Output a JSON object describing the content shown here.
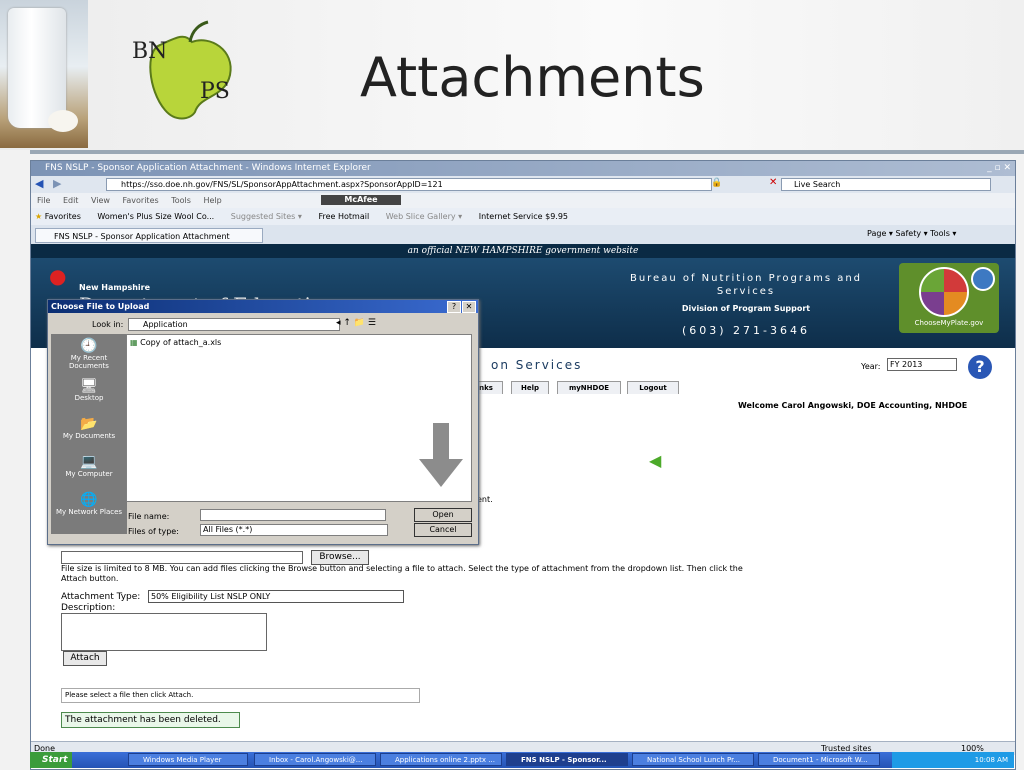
{
  "slide": {
    "title": "Attachments",
    "logo_top": "BN",
    "logo_bottom": "PS"
  },
  "ie": {
    "title": "FNS NSLP - Sponsor Application Attachment - Windows Internet Explorer",
    "address": "https://sso.doe.nh.gov/FNS/SL/SponsorAppAttachment.aspx?SponsorAppID=121",
    "search_placeholder": "Live Search",
    "menu": [
      "File",
      "Edit",
      "View",
      "Favorites",
      "Tools",
      "Help"
    ],
    "mcafee": "McAfee",
    "favorites_label": "Favorites",
    "favorites": [
      "Women's Plus Size Wool Co...",
      "Suggested Sites ▾",
      "Free Hotmail",
      "Web Slice Gallery ▾",
      "Internet Service $9.95"
    ],
    "tab_label": "FNS NSLP - Sponsor Application Attachment",
    "cmd": "Page ▾  Safety ▾  Tools ▾",
    "status_left": "Done",
    "status_zone": "Trusted sites",
    "zoom": "100%"
  },
  "site": {
    "strip": "an official NEW HAMPSHIRE government website",
    "doe_small": "New Hampshire",
    "doe_big": "Department of Education",
    "bureau": "Bureau of Nutrition Programs and Services",
    "division": "Division of Program Support",
    "phone": "(603) 271-3646",
    "myplate": "ChooseMyPlate.gov",
    "services_fragment": "on Services",
    "year_label": "Year:",
    "year_value": "FY 2013",
    "nav": [
      "nks",
      "Help",
      "myNHDOE",
      "Logout"
    ],
    "welcome": "Welcome Carol Angowski, DOE Accounting, NHDOE",
    "ment": "ent.",
    "browse": "Browse...",
    "info": "File size is limited to 8 MB. You can add files clicking the Browse button and selecting a file to attach. Select the type of attachment from the dropdown list. Then click the Attach button.",
    "attachment_type_label": "Attachment Type:",
    "attachment_type_value": "50% Eligibility List NSLP ONLY",
    "description_label": "Description:",
    "attach_button": "Attach",
    "status_select": "Please select a file then click Attach.",
    "status_deleted": "The attachment has been deleted."
  },
  "dialog": {
    "title": "Choose File to Upload",
    "look_in_label": "Look in:",
    "look_in_value": "Application",
    "places": [
      "My Recent Documents",
      "Desktop",
      "My Documents",
      "My Computer",
      "My Network Places"
    ],
    "file": "Copy of attach_a.xls",
    "file_name_label": "File name:",
    "files_of_type_label": "Files of type:",
    "files_of_type_value": "All Files (*.*)",
    "open": "Open",
    "cancel": "Cancel"
  },
  "taskbar": {
    "start": "Start",
    "tasks": [
      "Windows Media Player",
      "Inbox - Carol.Angowski@...",
      "Applications online 2.pptx ...",
      "FNS NSLP - Sponsor...",
      "National School Lunch Pr...",
      "Document1 - Microsoft W..."
    ],
    "clock": "10:08 AM"
  },
  "colors": {
    "ie_title": "#7c93b5",
    "banner": "#1d4b70",
    "taskbar": "#2453b4",
    "success": "#e9f7e9"
  }
}
